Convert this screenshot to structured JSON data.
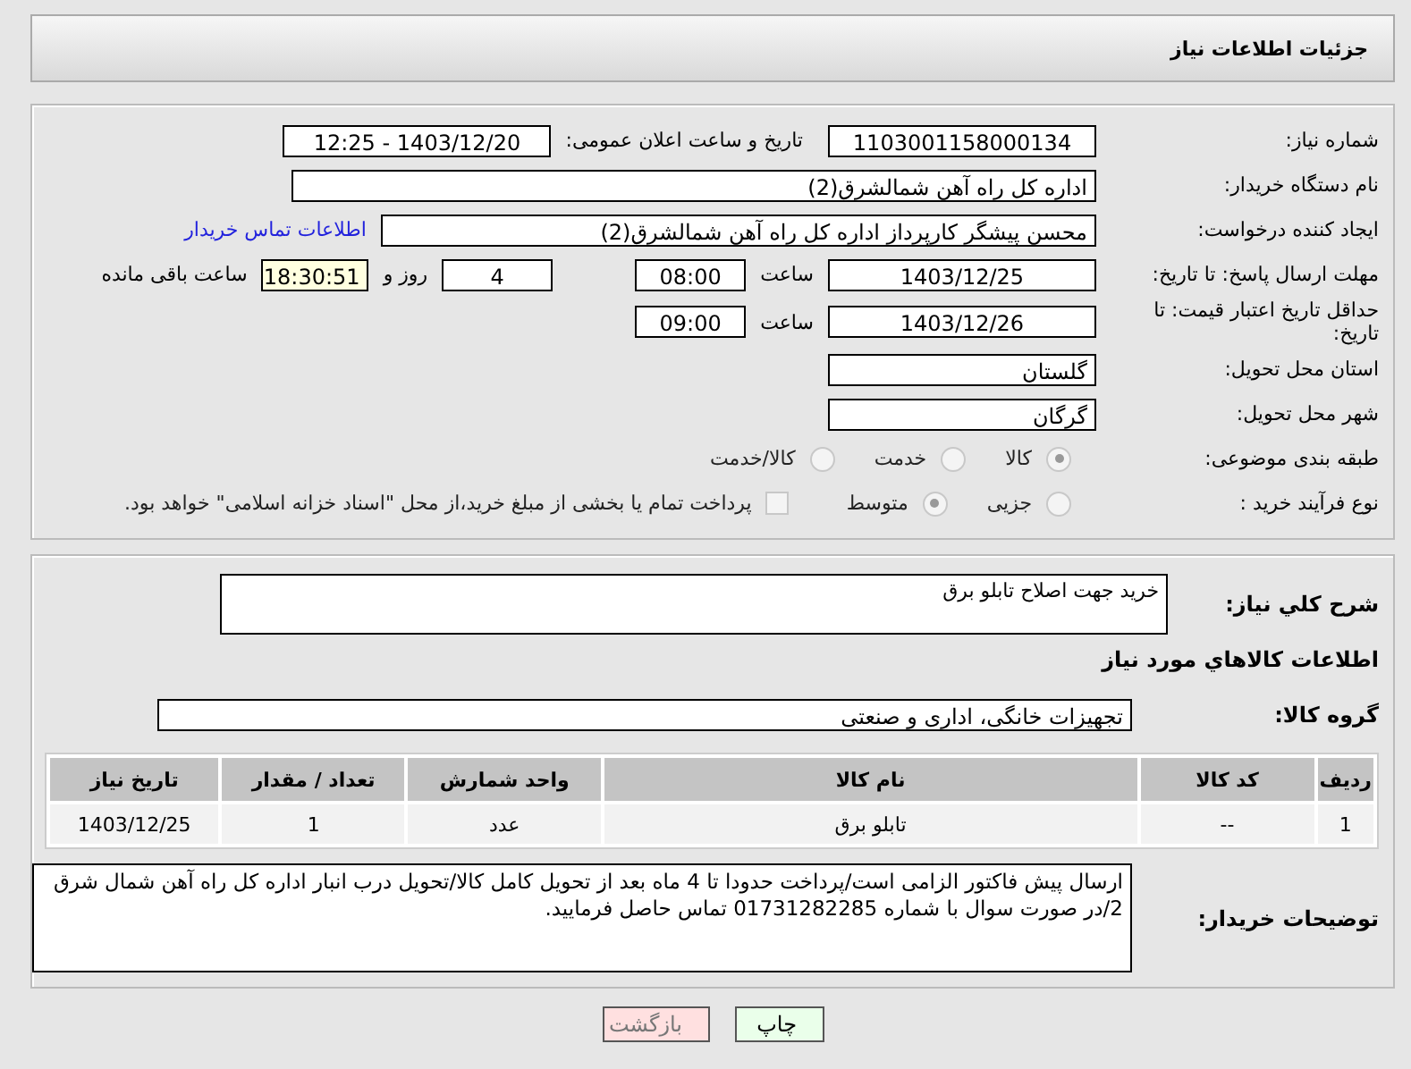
{
  "header": {
    "title": "جزئیات اطلاعات نیاز"
  },
  "form": {
    "need_number": {
      "label": "شماره نیاز:",
      "value": "1103001158000134"
    },
    "announce": {
      "label": "تاریخ و ساعت اعلان عمومی:",
      "value": "1403/12/20 - 12:25"
    },
    "buyer_org": {
      "label": "نام دستگاه خریدار:",
      "value": "اداره کل راه آهن شمالشرق(2)"
    },
    "requester": {
      "label": "ایجاد کننده درخواست:",
      "value": "محسن پیشگر کارپرداز اداره کل راه آهن شمالشرق(2)",
      "link": "اطلاعات تماس خریدار"
    },
    "deadline": {
      "label": "مهلت ارسال پاسخ: تا تاریخ:",
      "date": "1403/12/25",
      "time_label": "ساعت",
      "time": "08:00",
      "days": "4",
      "days_label": "روز و",
      "remaining": "18:30:51",
      "remaining_label": "ساعت باقی مانده"
    },
    "validity": {
      "label": "حداقل تاریخ اعتبار قیمت: تا تاریخ:",
      "date": "1403/12/26",
      "time_label": "ساعت",
      "time": "09:00"
    },
    "province": {
      "label": "استان محل تحویل:",
      "value": "گلستان"
    },
    "city": {
      "label": "شهر محل تحویل:",
      "value": "گرگان"
    },
    "category": {
      "label": "طبقه بندی موضوعی:",
      "options": [
        {
          "label": "کالا",
          "selected": true
        },
        {
          "label": "خدمت",
          "selected": false
        },
        {
          "label": "کالا/خدمت",
          "selected": false
        }
      ]
    },
    "process": {
      "label": "نوع فرآیند خرید :",
      "options": [
        {
          "label": "جزیی",
          "selected": false
        },
        {
          "label": "متوسط",
          "selected": true
        }
      ],
      "payment": {
        "label": "پرداخت تمام یا بخشی از مبلغ خرید،از محل \"اسناد خزانه اسلامی\" خواهد بود.",
        "checked": false
      }
    }
  },
  "details": {
    "description": {
      "label": "شرح کلي نياز:",
      "value": "خرید جهت اصلاح تابلو برق"
    },
    "goods_title": "اطلاعات کالاهاي مورد نياز",
    "goods_group": {
      "label": "گروه کالا:",
      "value": "تجهیزات خانگی، اداری و صنعتی"
    },
    "table": {
      "columns": [
        "ردیف",
        "کد کالا",
        "نام کالا",
        "واحد شمارش",
        "تعداد / مقدار",
        "تاریخ نیاز"
      ],
      "rows": [
        [
          "1",
          "--",
          "تابلو برق",
          "عدد",
          "1",
          "1403/12/25"
        ]
      ]
    },
    "buyer_notes": {
      "label": "توضیحات خریدار:",
      "value": "ارسال پیش فاکتور الزامی است/پرداخت حدودا تا 4 ماه بعد از تحویل کامل کالا/تحویل درب انبار اداره کل راه آهن شمال شرق 2/در صورت سوال با شماره 01731282285 تماس حاصل فرمایید."
    }
  },
  "buttons": [
    {
      "kind": "print",
      "label": "چاپ"
    },
    {
      "kind": "back",
      "label": "بازگشت"
    }
  ]
}
